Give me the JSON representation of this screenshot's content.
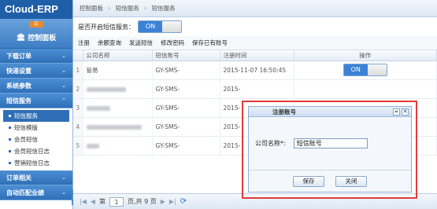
{
  "app": {
    "brand": "Cloud-ERP"
  },
  "sidebar": {
    "collapse_label": "☰",
    "panel_title": "控制面板",
    "groups": [
      {
        "label": "下载订单"
      },
      {
        "label": "快递设置"
      },
      {
        "label": "系统参数"
      },
      {
        "label": "短信服务"
      },
      {
        "label": "订单相关"
      },
      {
        "label": "自动匹配业绩"
      }
    ],
    "sms_items": [
      {
        "label": "短信服务"
      },
      {
        "label": "短信模版"
      },
      {
        "label": "会员短信"
      },
      {
        "label": "会员短信日志"
      },
      {
        "label": "营销短信日志"
      }
    ]
  },
  "breadcrumb": {
    "item1": "控制面板",
    "item2": "短信服务",
    "item3": "短信服务"
  },
  "toggle_row": {
    "label": "是否开启短信服务：",
    "state": "ON"
  },
  "toolbar": {
    "register": "注册",
    "balance": "余额查询",
    "send": "发送短信",
    "change_pwd": "修改密码",
    "save_existing": "保存已有账号"
  },
  "table": {
    "headers": [
      "公司名称",
      "短信账号",
      "注册时间",
      "操作"
    ],
    "rows": [
      {
        "num": "1",
        "company": "管易",
        "account": "GY-SMS-",
        "time": "2015-11-07 16:50:45",
        "state": "ON"
      },
      {
        "num": "2",
        "company": "",
        "account": "GY-SMS-",
        "time": "2015-"
      },
      {
        "num": "3",
        "company": "",
        "account": "GY-SMS-",
        "time": "2015-"
      },
      {
        "num": "4",
        "company": "",
        "account": "GY-SMS-",
        "time": "2015-"
      },
      {
        "num": "5",
        "company": "",
        "account": "GY-SMS-",
        "time": "2015-"
      }
    ]
  },
  "pager": {
    "page_label": "第",
    "page_value": "1",
    "total_label": "页,共 9 页"
  },
  "dialog": {
    "title": "注册账号",
    "field_label": "公司名称*:",
    "field_value": "短信账号",
    "save": "保存",
    "close": "关闭"
  }
}
